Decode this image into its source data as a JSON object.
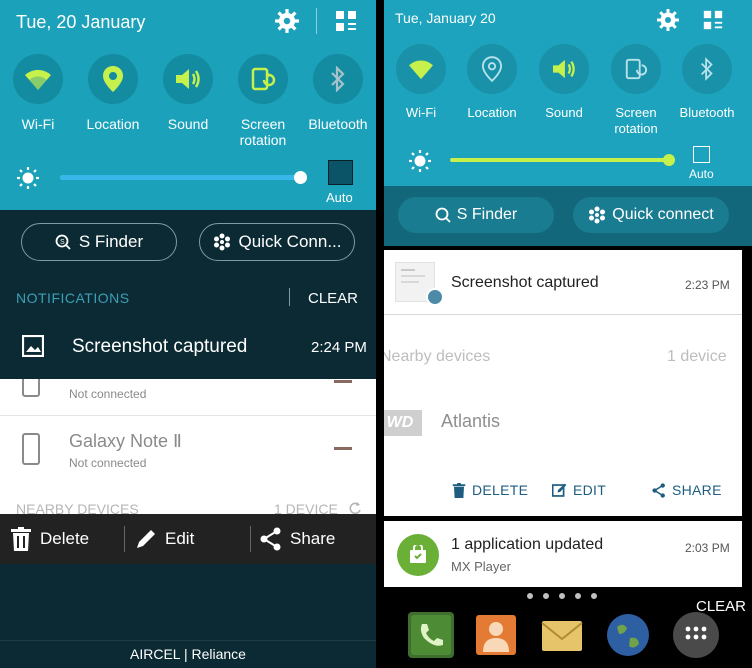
{
  "left": {
    "date": "Tue, 20 January",
    "quick_settings": [
      {
        "label": "Wi-Fi",
        "icon": "wifi-icon"
      },
      {
        "label": "Location",
        "icon": "location-icon"
      },
      {
        "label": "Sound",
        "icon": "sound-icon"
      },
      {
        "label": "Screen rotation",
        "icon": "screen-rotation-icon"
      },
      {
        "label": "Bluetooth",
        "icon": "bluetooth-icon"
      }
    ],
    "brightness_level": 0.98,
    "auto_label": "Auto",
    "s_finder_label": "S Finder",
    "quick_connect_label": "Quick Conn...",
    "notifications_header": "NOTIFICATIONS",
    "clear_label": "CLEAR",
    "screenshot_title": "Screenshot captured",
    "screenshot_time": "2:24 PM",
    "devices": [
      {
        "name": "",
        "status": "Not connected"
      },
      {
        "name": "Galaxy Note Ⅱ",
        "status": "Not connected"
      }
    ],
    "nearby_header": "NEARBY DEVICES",
    "nearby_count": "1 DEVICE",
    "actions": {
      "delete": "Delete",
      "edit": "Edit",
      "share": "Share"
    },
    "carrier": "AIRCEL | Reliance"
  },
  "right": {
    "date": "Tue, January 20",
    "quick_settings": [
      {
        "label": "Wi-Fi",
        "icon": "wifi-icon"
      },
      {
        "label": "Location",
        "icon": "location-icon"
      },
      {
        "label": "Sound",
        "icon": "sound-icon"
      },
      {
        "label": "Screen rotation",
        "icon": "screen-rotation-icon"
      },
      {
        "label": "Bluetooth",
        "icon": "bluetooth-icon"
      }
    ],
    "brightness_level": 1.0,
    "auto_label": "Auto",
    "s_finder_label": "S Finder",
    "quick_connect_label": "Quick connect",
    "screenshot_title": "Screenshot captured",
    "screenshot_time": "2:23 PM",
    "nearby_header": "Nearby devices",
    "nearby_count": "1 device",
    "device_logo": "WD",
    "device_name": "Atlantis",
    "actions": {
      "delete": "DELETE",
      "edit": "EDIT",
      "share": "SHARE"
    },
    "app_update_title": "1 application updated",
    "app_update_sub": "MX Player",
    "app_update_time": "2:03 PM",
    "clear_label": "CLEAR",
    "dock": [
      "phone-icon",
      "contacts-icon",
      "email-icon",
      "internet-icon",
      "apps-icon"
    ]
  },
  "colors": {
    "left_header": "#1ba1b9",
    "left_background": "#0b2a33",
    "right_header": "#1da3bd",
    "right_button_row": "#13677a",
    "active_icon_left": "#c6f04c",
    "right_slider": "#c6f04c",
    "app_icon_green": "#6aaf36",
    "action_blue": "#1e5d80"
  }
}
